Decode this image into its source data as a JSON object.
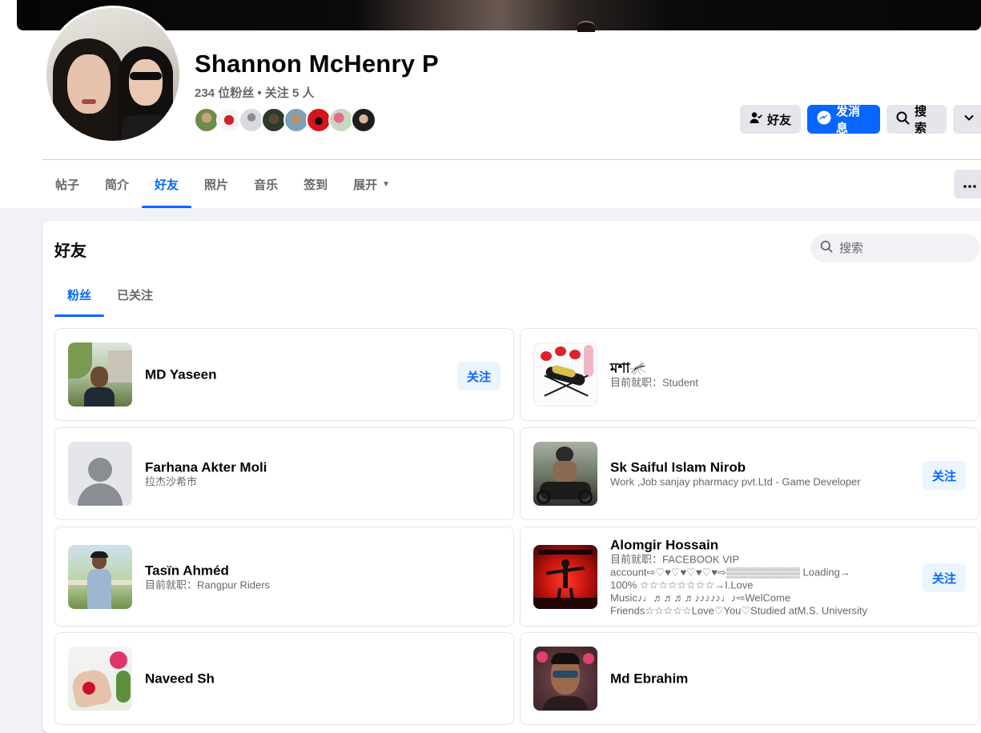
{
  "profile": {
    "name": "Shannon McHenry P",
    "stats": "234 位粉丝 • 关注 5 人"
  },
  "actions": {
    "friend_label": "好友",
    "message_label": "发消息",
    "search_label": "搜索"
  },
  "nav": {
    "tabs": [
      {
        "label": "帖子"
      },
      {
        "label": "简介"
      },
      {
        "label": "好友"
      },
      {
        "label": "照片"
      },
      {
        "label": "音乐"
      },
      {
        "label": "签到"
      },
      {
        "label": "展开"
      }
    ],
    "active_tab": "好友"
  },
  "friends_section": {
    "title": "好友",
    "search_placeholder": "搜索",
    "subtabs": [
      {
        "label": "粉丝"
      },
      {
        "label": "已关注"
      }
    ],
    "active_subtab": "粉丝",
    "follow_label": "关注",
    "items": [
      {
        "name": "MD Yaseen",
        "lines": [],
        "follow": true
      },
      {
        "name": "মশা🦟",
        "lines": [
          "目前就职：Student"
        ],
        "follow": false
      },
      {
        "name": "Farhana Akter Moli",
        "lines": [
          "拉杰沙希市"
        ],
        "follow": false
      },
      {
        "name": "Sk Saiful Islam Nirob",
        "lines": [
          "Work ,Job sanjay pharmacy pvt.Ltd - Game Developer"
        ],
        "follow": true
      },
      {
        "name": "Tasïn Ahméd",
        "lines": [
          "目前就职：Rangpur Riders"
        ],
        "follow": false
      },
      {
        "name": "Alomgir Hossain",
        "lines": [
          "目前就职：FACEBOOK VIP",
          "account⇨♡♥♡♥♡♥♡♥⇨▒▒▒▒▒▒▒▒▒▒ Loading→",
          "100% ☆☆☆☆☆☆☆☆→I.Love",
          "Music♪♩♬♬♬♬♪♪♪♪♪♩♪⇨WelCome",
          "Friends☆☆☆☆☆Love♡You♡Studied atM.S. University"
        ],
        "follow": true
      },
      {
        "name": "Naveed Sh",
        "lines": [],
        "follow": false
      },
      {
        "name": "Md Ebrahim",
        "lines": [],
        "follow": false
      }
    ]
  },
  "colors": {
    "accent": "#0866ff",
    "page_bg": "#f0f2f5",
    "secondary_text": "#65676b"
  }
}
